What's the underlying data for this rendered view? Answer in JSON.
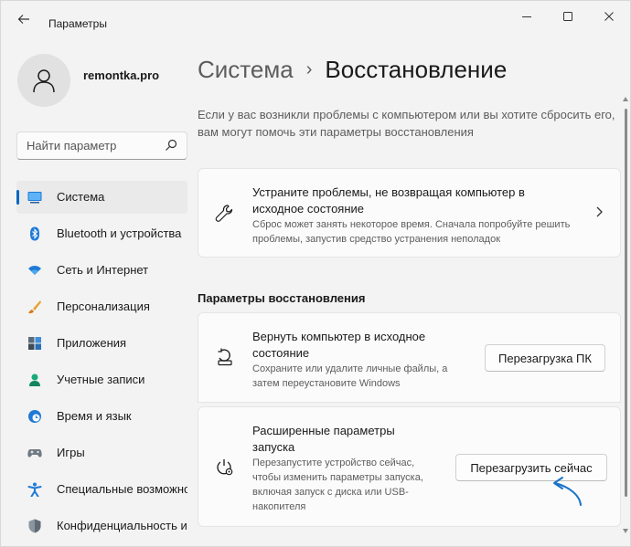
{
  "window": {
    "title": "Параметры",
    "controls": [
      "minimize",
      "maximize",
      "close"
    ]
  },
  "account": {
    "name": "remontka.pro"
  },
  "search": {
    "placeholder": "Найти параметр"
  },
  "sidebar": {
    "items": [
      {
        "label": "Система",
        "icon": "system-icon",
        "active": true
      },
      {
        "label": "Bluetooth и устройства",
        "icon": "bluetooth-icon"
      },
      {
        "label": "Сеть и Интернет",
        "icon": "wifi-icon"
      },
      {
        "label": "Персонализация",
        "icon": "brush-icon"
      },
      {
        "label": "Приложения",
        "icon": "apps-icon"
      },
      {
        "label": "Учетные записи",
        "icon": "accounts-icon"
      },
      {
        "label": "Время и язык",
        "icon": "clock-globe-icon"
      },
      {
        "label": "Игры",
        "icon": "gamepad-icon"
      },
      {
        "label": "Специальные возможности",
        "icon": "accessibility-icon"
      },
      {
        "label": "Конфиденциальность и защита",
        "icon": "shield-icon"
      }
    ]
  },
  "breadcrumb": {
    "parent": "Система",
    "separator": "›",
    "current": "Восстановление"
  },
  "intro": "Если у вас возникли проблемы с компьютером или вы хотите сбросить его, вам могут помочь эти параметры восстановления",
  "troubleshoot_card": {
    "title": "Устраните проблемы, не возвращая компьютер в исходное состояние",
    "description": "Сброс может занять некоторое время. Сначала попробуйте решить проблемы, запустив средство устранения неполадок",
    "icon": "wrench-icon"
  },
  "section_title": "Параметры восстановления",
  "reset_card": {
    "title": "Вернуть компьютер в исходное состояние",
    "description": "Сохраните или удалите личные файлы, а затем переустановите Windows",
    "button": "Перезагрузка ПК",
    "icon": "reset-pc-icon"
  },
  "advanced_card": {
    "title": "Расширенные параметры запуска",
    "description": "Перезапустите устройство сейчас, чтобы изменить параметры запуска, включая запуск с диска или USB-накопителя",
    "button": "Перезагрузить сейчас",
    "icon": "power-settings-icon"
  },
  "colors": {
    "accent": "#0067c0",
    "annotation": "#1a73c8"
  }
}
